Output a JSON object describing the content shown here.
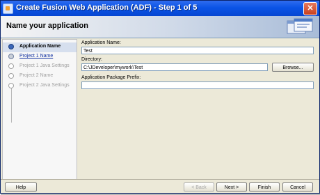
{
  "window": {
    "title": "Create Fusion Web Application (ADF) - Step 1 of 5",
    "close_glyph": "✕"
  },
  "header": {
    "title": "Name your application"
  },
  "steps": [
    {
      "label": "Application Name",
      "state": "current"
    },
    {
      "label": "Project 1 Name",
      "state": "link"
    },
    {
      "label": "Project 1 Java Settings",
      "state": "disabled"
    },
    {
      "label": "Project 2 Name",
      "state": "disabled"
    },
    {
      "label": "Project 2 Java Settings",
      "state": "disabled"
    }
  ],
  "form": {
    "app_name_label": "Application Name:",
    "app_name_value": "Test",
    "directory_label": "Directory:",
    "directory_value": "C:\\JDeveloper\\mywork\\Test",
    "browse_label": "Browse...",
    "package_prefix_label": "Application Package Prefix:",
    "package_prefix_value": ""
  },
  "footer": {
    "help_label": "Help",
    "back_label": "< Back",
    "next_label": "Next >",
    "finish_label": "Finish",
    "cancel_label": "Cancel"
  }
}
